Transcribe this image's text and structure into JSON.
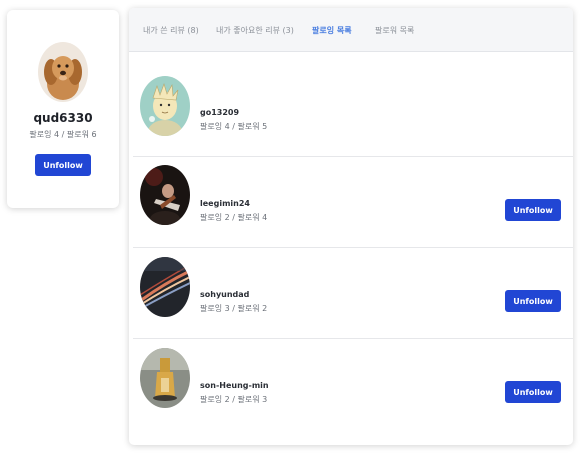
{
  "profile": {
    "username": "qud6330",
    "counts": "팔로잉 4 / 팔로워 6",
    "button_label": "Unfollow"
  },
  "tabs": [
    {
      "label": "내가 쓴 리뷰 (8)",
      "active": false
    },
    {
      "label": "내가 좋아요한 리뷰 (3)",
      "active": false
    },
    {
      "label": "팔로잉 목록",
      "active": true
    },
    {
      "label": "팔로워 목록",
      "active": false
    }
  ],
  "following": [
    {
      "username": "go13209",
      "counts": "팔로잉 4 / 팔로워 5",
      "button_label": null,
      "avatar": "cartoon-avatar"
    },
    {
      "username": "leegimin24",
      "counts": "팔로잉 2 / 팔로워 4",
      "button_label": "Unfollow",
      "avatar": "guitarist-photo"
    },
    {
      "username": "sohyundad",
      "counts": "팔로잉 3 / 팔로워 2",
      "button_label": "Unfollow",
      "avatar": "light-trails-photo"
    },
    {
      "username": "son-Heung-min",
      "counts": "팔로잉 2 / 팔로워 3",
      "button_label": "Unfollow",
      "avatar": "bottle-photo"
    }
  ],
  "colors": {
    "primary_button": "#2146d4",
    "active_tab": "#4a7ee0",
    "tab_bar_bg": "#f5f6f8"
  }
}
